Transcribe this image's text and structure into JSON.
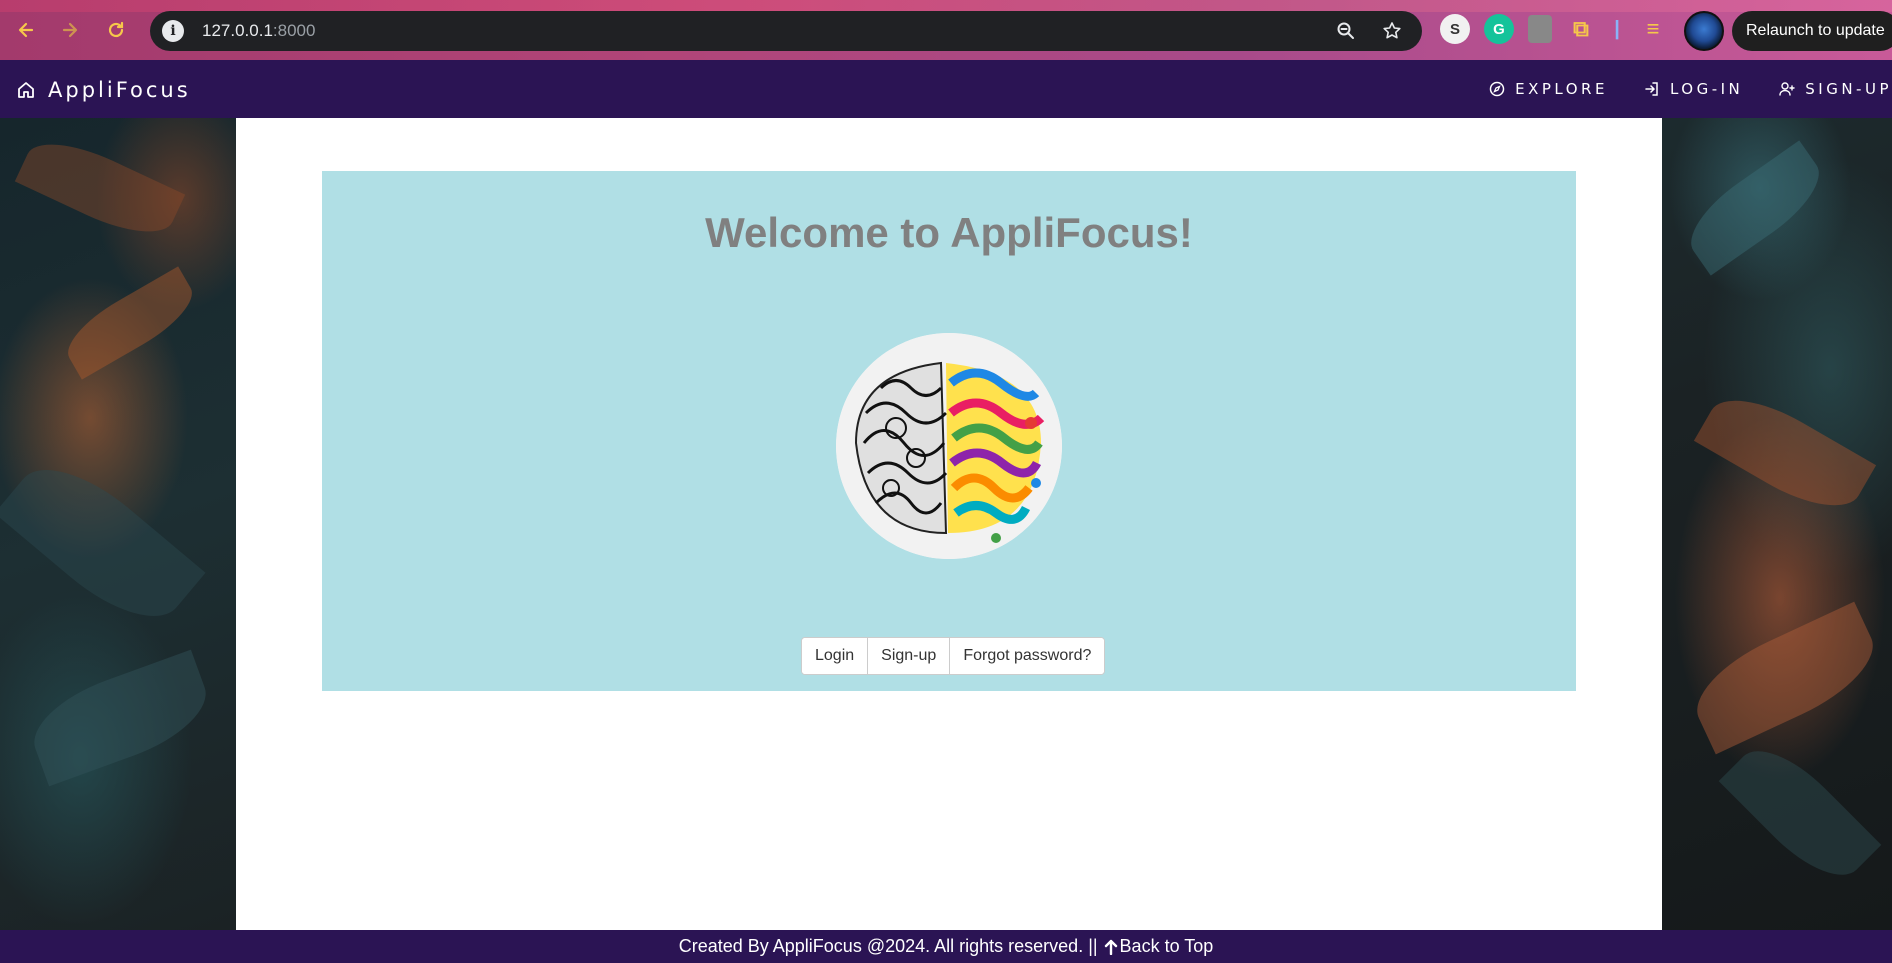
{
  "browser": {
    "url_host": "127.0.0.1",
    "url_port": ":8000",
    "relaunch_label": "Relaunch to update"
  },
  "nav": {
    "brand": "AppliFocus",
    "links": [
      {
        "label": "EXPLORE",
        "icon": "compass-icon"
      },
      {
        "label": "LOG-IN",
        "icon": "login-icon"
      },
      {
        "label": "SIGN-UP",
        "icon": "user-plus-icon"
      }
    ]
  },
  "hero": {
    "title": "Welcome to AppliFocus!",
    "image": "brain-illustration",
    "buttons": [
      "Login",
      "Sign-up",
      "Forgot password?"
    ]
  },
  "footer": {
    "text": "Created By AppliFocus @2024. All rights reserved. ||",
    "back_to_top": "Back to Top"
  },
  "colors": {
    "nav_bg": "#2b1454",
    "hero_bg": "#b0dfe5",
    "title_color": "#808080"
  }
}
